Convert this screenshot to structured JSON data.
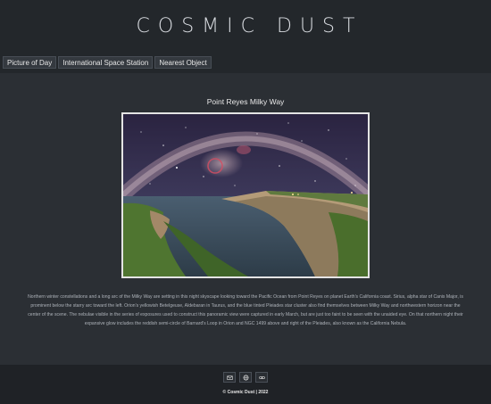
{
  "header": {
    "title": "COSMIC DUST"
  },
  "nav": {
    "tabs": [
      {
        "label": "Picture of Day"
      },
      {
        "label": "International Space Station"
      },
      {
        "label": "Nearest Object"
      }
    ]
  },
  "main": {
    "photo_title": "Point Reyes Milky Way",
    "explanation": "Northern winter constellations and a long arc of the Milky Way are setting in this night skyscape looking toward the Pacific Ocean from Point Reyes on planet Earth's California coast. Sirius, alpha star of Canis Major, is prominent below the starry arc toward the left. Orion's yellowish Betelgeuse, Aldebaran in Taurus, and the blue tinted Pleiades star cluster also find themselves between Milky Way and northwestern horizon near the center of the scene. The nebulae visible in the series of exposures used to construct this panoramic view were captured in early March, but are just too faint to be seen with the unaided eye. On that northern night their expansive glow includes the reddish semi-circle of Barnard's Loop in Orion and NGC 1499 above and right of the Pleiades, also known as the California Nebula."
  },
  "footer": {
    "icons": [
      "mail-icon",
      "globe-icon",
      "link-icon"
    ],
    "copyright": "© Cosmic Dust | 2022"
  }
}
